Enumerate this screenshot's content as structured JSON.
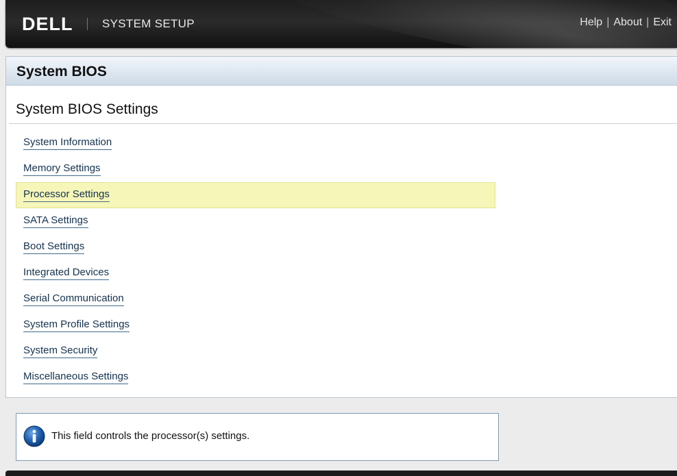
{
  "header": {
    "brand": "DELL",
    "title": "SYSTEM SETUP",
    "links": [
      "Help",
      "About",
      "Exit"
    ]
  },
  "panel": {
    "title": "System BIOS",
    "section_title": "System BIOS Settings"
  },
  "menu": {
    "selected": "Processor Settings",
    "items": [
      "System Information",
      "Memory Settings",
      "Processor Settings",
      "SATA Settings",
      "Boot Settings",
      "Integrated Devices",
      "Serial Communication",
      "System Profile Settings",
      "System Security",
      "Miscellaneous Settings"
    ]
  },
  "help": {
    "icon": "info-icon",
    "text": "This field controls the processor(s) settings."
  },
  "colors": {
    "selection_highlight": "#f6f6b8",
    "header_bar": "#1d1d1d",
    "panel_header": "#dfe8f2",
    "link_text": "#14324e"
  }
}
